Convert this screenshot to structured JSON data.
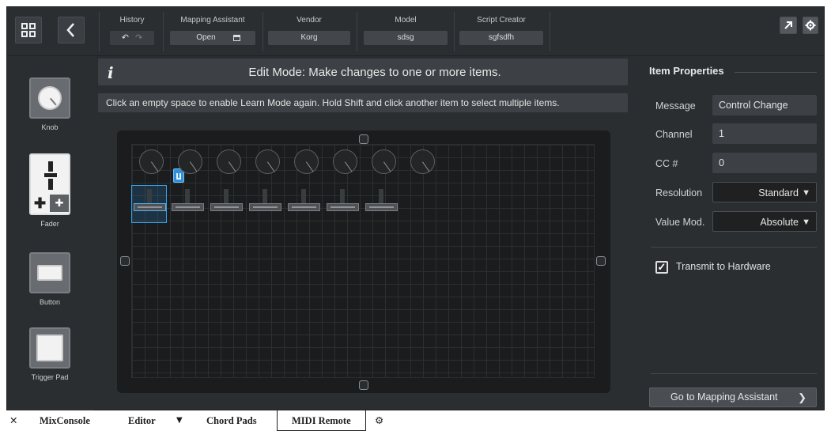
{
  "topbar": {
    "history": {
      "label": "History"
    },
    "mapping_assistant": {
      "label": "Mapping Assistant",
      "value": "Open"
    },
    "vendor": {
      "label": "Vendor",
      "value": "Korg"
    },
    "model": {
      "label": "Model",
      "value": "sdsg"
    },
    "script_creator": {
      "label": "Script Creator",
      "value": "sgfsdfh"
    },
    "icons": {
      "grid": "grid-icon",
      "back": "chevron-left-icon",
      "undo": "undo-icon",
      "redo": "redo-icon",
      "window": "window-icon",
      "external": "arrow-up-right-icon",
      "settings": "gear-icon"
    }
  },
  "palette": {
    "items": [
      {
        "label": "Knob",
        "icon": "knob-icon"
      },
      {
        "label": "Fader",
        "icon": "fader-icon"
      },
      {
        "label": "Button",
        "icon": "button-icon"
      },
      {
        "label": "Trigger Pad",
        "icon": "trigger-pad-icon"
      }
    ]
  },
  "center": {
    "info_glyph": "i",
    "edit_mode_text": "Edit Mode: Make changes to one or more items.",
    "hint_text": "Click an empty space to enable Learn Mode again. Hold Shift and click another item to select multiple items."
  },
  "properties": {
    "title": "Item Properties",
    "rows": [
      {
        "key": "Message",
        "value": "Control Change"
      },
      {
        "key": "Channel",
        "value": "1"
      },
      {
        "key": "CC #",
        "value": "0"
      },
      {
        "key": "Resolution",
        "value": "Standard",
        "caret": "▼"
      },
      {
        "key": "Value Mod.",
        "value": "Absolute",
        "caret": "▼"
      }
    ],
    "transmit": {
      "label": "Transmit to Hardware",
      "checked": true,
      "mark": "✓"
    },
    "goto_button": {
      "label": "Go to Mapping Assistant",
      "chevron": "❯"
    }
  },
  "tabs": {
    "close_glyph": "✕",
    "items": [
      "MixConsole",
      "Editor",
      "Chord Pads",
      "MIDI Remote"
    ],
    "dropdown_glyph": "▼",
    "active": "MIDI Remote"
  },
  "colors": {
    "background": "#2b2e31",
    "selection": "#3aa0e0",
    "canvas": "#1a1c1e"
  }
}
